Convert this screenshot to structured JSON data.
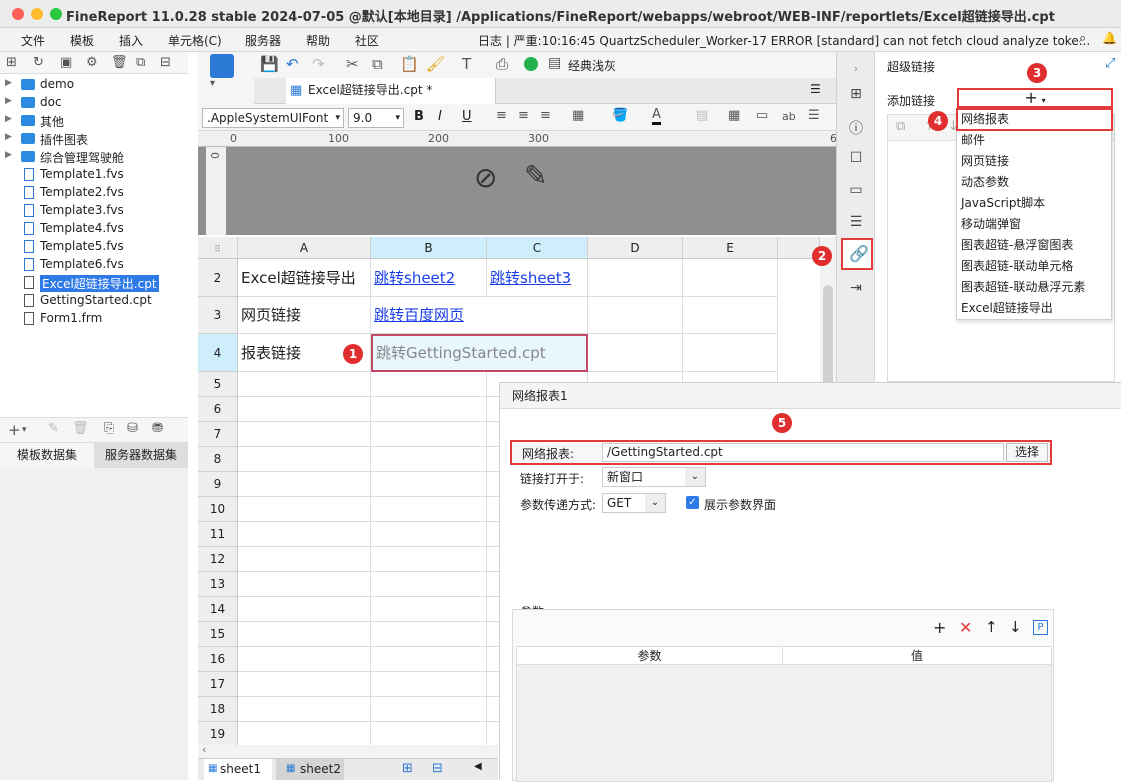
{
  "window": {
    "title": "FineReport 11.0.28 stable 2024-07-05 @默认[本地目录]   /Applications/FineReport/webapps/webroot/WEB-INF/reportlets/Excel超链接导出.cpt"
  },
  "menu": {
    "items": [
      "文件",
      "模板",
      "插入",
      "单元格(C)",
      "服务器",
      "帮助",
      "社区"
    ],
    "log": "日志 | 严重:10:16:45 QuartzScheduler_Worker-17 ERROR [standard] can not fetch cloud analyze toke..."
  },
  "tree": {
    "folders": [
      "demo",
      "doc",
      "其他",
      "插件图表",
      "综合管理驾驶舱"
    ],
    "files": [
      "Template1.fvs",
      "Template2.fvs",
      "Template3.fvs",
      "Template4.fvs",
      "Template5.fvs",
      "Template6.fvs",
      "Excel超链接导出.cpt",
      "GettingStarted.cpt",
      "Form1.frm"
    ],
    "selected_file": "Excel超链接导出.cpt"
  },
  "dataset_tabs": [
    "模板数据集",
    "服务器数据集"
  ],
  "toolbar": {
    "theme_label": "经典浅灰"
  },
  "doc_tab": {
    "label": "Excel超链接导出.cpt *"
  },
  "format": {
    "font": ".AppleSystemUIFont",
    "size": "9.0",
    "bold": "B",
    "italic": "I",
    "underline": "U",
    "ab": "ab"
  },
  "ruler": {
    "marks": [
      "0",
      "100",
      "200",
      "300",
      "6"
    ],
    "vmark": "0"
  },
  "sheet": {
    "columns": [
      "A",
      "B",
      "C",
      "D",
      "E"
    ],
    "rows": [
      "2",
      "3",
      "4",
      "5",
      "6",
      "7",
      "8",
      "9",
      "10",
      "11",
      "12",
      "13",
      "14",
      "15",
      "16",
      "17",
      "18",
      "19"
    ],
    "cells": {
      "a2": "Excel超链接导出",
      "b2": "跳转sheet2",
      "c2": "跳转sheet3",
      "a3": "网页链接",
      "b3": "跳转百度网页",
      "a4": "报表链接",
      "b4": "跳转GettingStarted.cpt"
    },
    "tabs": [
      "sheet1",
      "sheet2"
    ]
  },
  "hyperlink_panel": {
    "title": "超级链接",
    "add_label": "添加链接",
    "add_symbol": "+",
    "menu_items": [
      "网络报表",
      "邮件",
      "网页链接",
      "动态参数",
      "JavaScript脚本",
      "移动端弹窗",
      "图表超链-悬浮窗图表",
      "图表超链-联动单元格",
      "图表超链-联动悬浮元素",
      "Excel超链接导出"
    ]
  },
  "dialog": {
    "title": "网络报表1",
    "report_label": "网络报表:",
    "report_value": "/GettingStarted.cpt",
    "select_button": "选择",
    "open_label": "链接打开于:",
    "open_value": "新窗口",
    "method_label": "参数传递方式:",
    "method_value": "GET",
    "show_params_label": "展示参数界面",
    "show_params_checked": true,
    "params_group": "参数",
    "param_col": "参数",
    "value_col": "值"
  },
  "badges": [
    "1",
    "2",
    "3",
    "4",
    "5"
  ],
  "colors": {
    "accent": "#2e7ae6",
    "link": "#1a3ee8",
    "highlight_red": "#e23b3b"
  }
}
